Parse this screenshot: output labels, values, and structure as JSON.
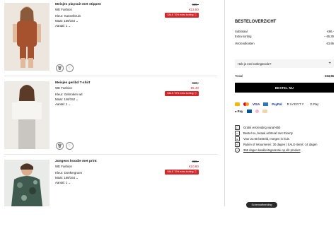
{
  "items": [
    {
      "name": "Meisjes playsuit met stippen",
      "brand": "WE Fashion",
      "color_label": "Kleur: Kaneelbruin",
      "size_label": "Maat: 158/164",
      "qty_label": "Aantal: 1",
      "old_price": "€25,-",
      "new_price": "€13,50",
      "badge": "SALE 70% extra korting"
    },
    {
      "name": "Meisjes geribd T-shirt",
      "brand": "WE Fashion",
      "color_label": "Kleur: Gebroken wit",
      "size_label": "Maat: 146/152",
      "qty_label": "Aantal: 1",
      "old_price": "€10,-",
      "new_price": "€5,40",
      "badge": "SALE 70% extra korting"
    },
    {
      "name": "Jongens hoodie met print",
      "brand": "WE Fashion",
      "color_label": "Kleur: Donkergroen",
      "size_label": "Maat: 158/164",
      "qty_label": "Aantal: 1",
      "old_price": "€20,-",
      "new_price": "€10,80",
      "badge": "SALE 70% extra korting"
    }
  ],
  "summary": {
    "title": "BESTELOVERZICHT",
    "subtotal_label": "Subtotaal",
    "subtotal_value": "€66,-",
    "discount_label": "Extra korting",
    "discount_value": "– €5,30",
    "shipping_label": "Verzendkosten",
    "shipping_value": "€3,95",
    "coupon_label": "Heb je een kortingscode?",
    "coupon_icon": "+",
    "total_label": "Totaal",
    "total_value": "€33,65",
    "cta_label": "BESTEL NU"
  },
  "payment": {
    "row1": [
      "VISA",
      "PayPal",
      "RIVERTY",
      "G Pay"
    ],
    "row2": [
      "Pay"
    ]
  },
  "usps": [
    "Gratis verzending vanaf €50",
    "Bestel nu, betaal achteraf met Riverty",
    "Voor 21:00 besteld, morgen in huis",
    "Ruilen of retourneren: 30 dagen | SALE-items: 14 dagen",
    "365 dagen kwaliteitsgarantie op elk product"
  ],
  "toast": "Schermafbeelding",
  "colors": {
    "sale_red": "#d2262a",
    "cta_black": "#000000"
  }
}
